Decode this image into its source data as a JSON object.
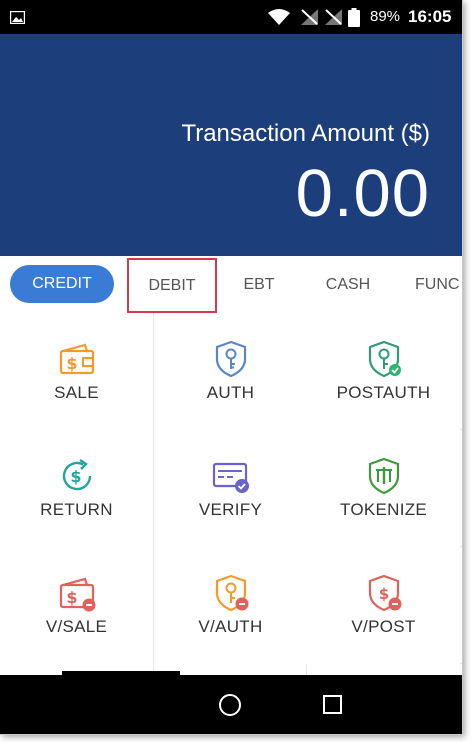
{
  "status_bar": {
    "battery_percent": "89%",
    "time": "16:05",
    "icons": [
      "image-icon",
      "wifi-icon",
      "no-signal-icon",
      "no-signal-icon",
      "battery-icon"
    ]
  },
  "header": {
    "label": "Transaction Amount ($)",
    "amount": "0.00",
    "background": "#1c3f7b"
  },
  "tabs": {
    "items": [
      {
        "label": "CREDIT",
        "selected": true
      },
      {
        "label": "DEBIT",
        "highlighted": true
      },
      {
        "label": "EBT"
      },
      {
        "label": "CASH"
      },
      {
        "label": "FUNC"
      }
    ],
    "active_color": "#3a7bd5",
    "highlight_color": "#d33a4a"
  },
  "actions": [
    {
      "label": "SALE",
      "icon": "wallet-dollar-icon"
    },
    {
      "label": "AUTH",
      "icon": "shield-key-icon"
    },
    {
      "label": "POSTAUTH",
      "icon": "shield-key-check-icon"
    },
    {
      "label": "RETURN",
      "icon": "dollar-return-icon"
    },
    {
      "label": "VERIFY",
      "icon": "card-check-icon"
    },
    {
      "label": "TOKENIZE",
      "icon": "shield-token-icon"
    },
    {
      "label": "V/SALE",
      "icon": "wallet-void-icon"
    },
    {
      "label": "V/AUTH",
      "icon": "shield-key-void-icon"
    },
    {
      "label": "V/POST",
      "icon": "shield-dollar-void-icon"
    }
  ],
  "nav_bar": {
    "buttons": [
      "home-button",
      "recents-button"
    ]
  }
}
